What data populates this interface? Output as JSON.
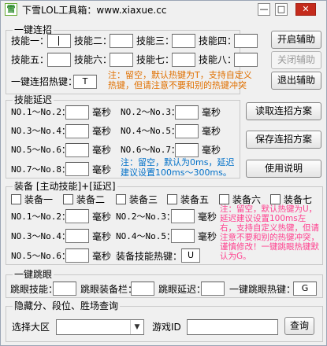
{
  "window": {
    "title": "下雪LOL工具箱：www.xiaxue.cc",
    "min": "—",
    "max": "□",
    "close": "✕"
  },
  "combo": {
    "legend": "一键连招",
    "skill_labels": [
      "技能一：",
      "技能二：",
      "技能三：",
      "技能四：",
      "技能五：",
      "技能六：",
      "技能七：",
      "技能八："
    ],
    "skill_values": [
      "",
      "",
      "",
      "",
      "",
      "",
      "",
      ""
    ],
    "hotkey_label": "一键连招热键：",
    "hotkey_value": "T",
    "note": "注：留空，默认热键为T，支持自定义热键，但请注意不要和别的热键冲突"
  },
  "buttons": {
    "start": "开启辅助",
    "stop": "关闭辅助",
    "exit": "退出辅助",
    "read": "读取连招方案",
    "save": "保存连招方案",
    "help": "使用说明",
    "query": "查询"
  },
  "delay": {
    "legend": "技能延迟",
    "rows": [
      {
        "label": "NO.1～No.2：",
        "unit": "毫秒",
        "value": ""
      },
      {
        "label": "NO.2～No.3：",
        "unit": "毫秒",
        "value": ""
      },
      {
        "label": "NO.3～No.4：",
        "unit": "毫秒",
        "value": ""
      },
      {
        "label": "NO.4～No.5：",
        "unit": "毫秒",
        "value": ""
      },
      {
        "label": "NO.5～No.6：",
        "unit": "毫秒",
        "value": ""
      },
      {
        "label": "NO.6～No.7：",
        "unit": "毫秒",
        "value": ""
      },
      {
        "label": "NO.7～No.8：",
        "unit": "毫秒",
        "value": ""
      }
    ],
    "note": "注：留空，默认为0ms，延迟建议设置100ms～300ms。"
  },
  "equip": {
    "legend": "装备 [主动技能]+[延迟]",
    "items": [
      "装备一",
      "装备二",
      "装备三",
      "装备五",
      "装备六",
      "装备七"
    ],
    "rows": [
      {
        "label": "NO.1～No.2：",
        "unit": "毫秒",
        "value": ""
      },
      {
        "label": "NO.2～No.3：",
        "unit": "毫秒",
        "value": ""
      },
      {
        "label": "NO.3～No.4：",
        "unit": "毫秒",
        "value": ""
      },
      {
        "label": "NO.4～No.5：",
        "unit": "毫秒",
        "value": ""
      },
      {
        "label": "NO.5～No.6：",
        "unit": "毫秒",
        "value": ""
      }
    ],
    "hotkey_label": "装备技能热键：",
    "hotkey_value": "U",
    "note": "注：留空，默认热键为U，延迟建议设置100ms左右，支持自定义热键，但请注意不要和别的热键冲突，谨慎修改！一键跳眼热键默认为G。"
  },
  "ward": {
    "legend": "一键跳眼",
    "skill_label": "跳眼技能：",
    "slot_label": "跳眼装备栏：",
    "delay_label": "跳眼延迟：",
    "hotkey_label": "一键跳眼热键：",
    "hotkey_value": "G",
    "skill_value": "",
    "slot_value": "",
    "delay_value": ""
  },
  "query": {
    "legend": "隐藏分、段位、胜场查询",
    "region_label": "选择大区",
    "region_value": "",
    "id_label": "游戏ID",
    "id_value": ""
  }
}
